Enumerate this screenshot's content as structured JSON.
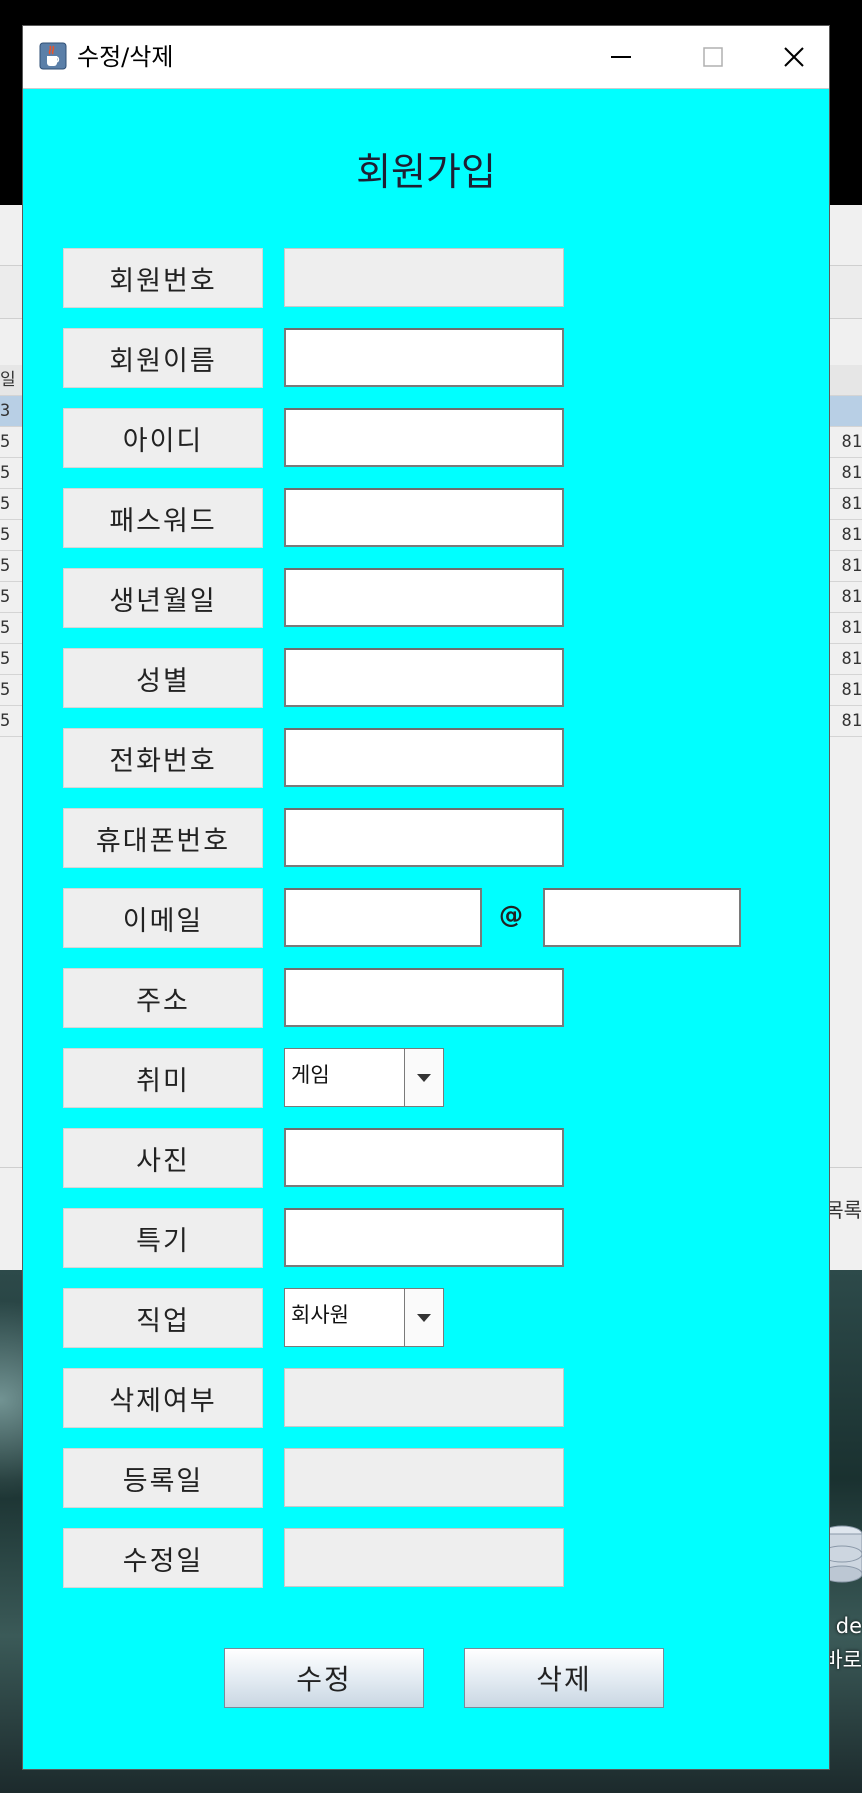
{
  "background": {
    "table_header_left": "일",
    "rows_left": [
      "3",
      "5",
      "5",
      "5",
      "5",
      "5",
      "5",
      "5",
      "5",
      "5",
      "5"
    ],
    "rows_right": [
      "",
      "81",
      "81",
      "81",
      "81",
      "81",
      "81",
      "81",
      "81",
      "81",
      "81"
    ],
    "bottom_right_text": "목록",
    "desktop_label_1": "de",
    "desktop_label_2": "바로"
  },
  "window": {
    "title": "수정/삭제",
    "icon": "java-cup-icon"
  },
  "form": {
    "heading": "회원가입",
    "fields": [
      {
        "label": "회원번호",
        "value": "",
        "readonly": true
      },
      {
        "label": "회원이름",
        "value": ""
      },
      {
        "label": "아이디",
        "value": ""
      },
      {
        "label": "패스워드",
        "value": ""
      },
      {
        "label": "생년월일",
        "value": ""
      },
      {
        "label": "성별",
        "value": ""
      },
      {
        "label": "전화번호",
        "value": ""
      },
      {
        "label": "휴대폰번호",
        "value": ""
      },
      {
        "label": "이메일",
        "local_value": "",
        "at": "@",
        "domain_value": ""
      },
      {
        "label": "주소",
        "value": ""
      },
      {
        "label": "취미",
        "selected": "게임"
      },
      {
        "label": "사진",
        "value": ""
      },
      {
        "label": "특기",
        "value": ""
      },
      {
        "label": "직업",
        "selected": "회사원"
      },
      {
        "label": "삭제여부",
        "value": "",
        "readonly": true
      },
      {
        "label": "등록일",
        "value": "",
        "readonly": true
      },
      {
        "label": "수정일",
        "value": "",
        "readonly": true
      }
    ],
    "buttons": {
      "update": "수정",
      "delete": "삭제"
    }
  },
  "colors": {
    "dialog_background": "#00ffff",
    "label_background": "#eeeeee"
  }
}
